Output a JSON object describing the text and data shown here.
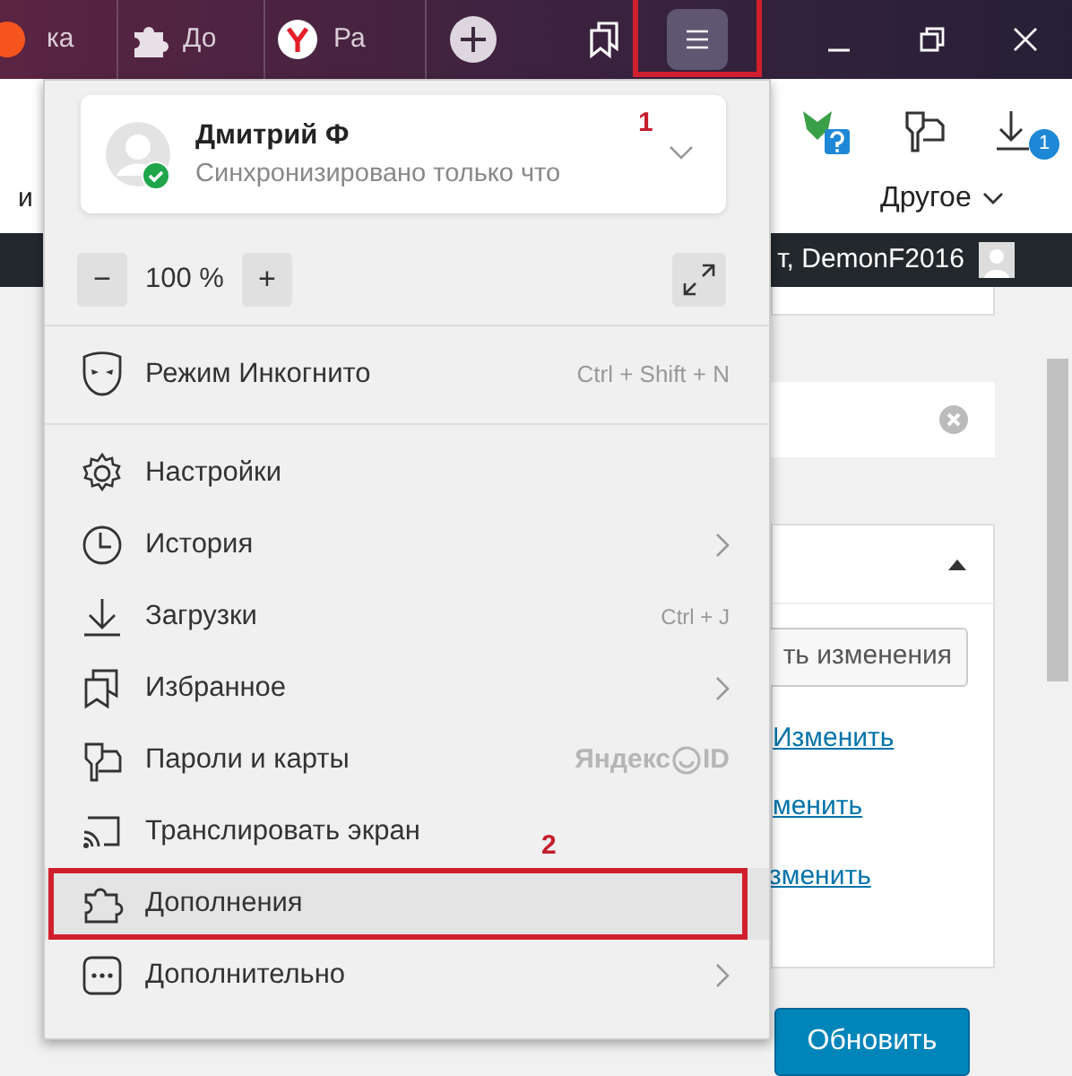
{
  "browser": {
    "tabs": [
      {
        "title": "ка"
      },
      {
        "title": "До"
      },
      {
        "title": "Ра"
      }
    ],
    "menu_button": {
      "highlighted": true
    },
    "toolbar": {
      "left_text": "и",
      "bookmarks_label": "Другое",
      "download_badge": "1"
    }
  },
  "page": {
    "admin_greeting": "т, DemonF2016",
    "save_button": "ть изменения",
    "links": [
      "Изменить",
      "менить",
      "зменить"
    ],
    "update_button": "Обновить"
  },
  "menu": {
    "profile": {
      "name": "Дмитрий Ф",
      "status": "Синхронизировано только что",
      "synced": true
    },
    "zoom": {
      "minus": "−",
      "level": "100 %",
      "plus": "+"
    },
    "incognito": {
      "label": "Режим Инкогнито",
      "shortcut": "Ctrl + Shift + N"
    },
    "items": [
      {
        "label": "Настройки",
        "highlighted": false
      },
      {
        "label": "История",
        "submenu": true,
        "highlighted": false
      },
      {
        "label": "Загрузки",
        "shortcut": "Ctrl + J",
        "highlighted": false
      },
      {
        "label": "Избранное",
        "submenu": true,
        "highlighted": false
      },
      {
        "label": "Пароли и карты",
        "brand": [
          "Яндекс",
          "ID"
        ],
        "highlighted": false
      },
      {
        "label": "Транслировать экран",
        "highlighted": false
      },
      {
        "label": "Дополнения",
        "highlighted": true
      },
      {
        "label": "Дополнительно",
        "submenu": true,
        "highlighted": false
      }
    ]
  },
  "annotations": [
    {
      "label": "1"
    },
    {
      "label": "2"
    }
  ]
}
